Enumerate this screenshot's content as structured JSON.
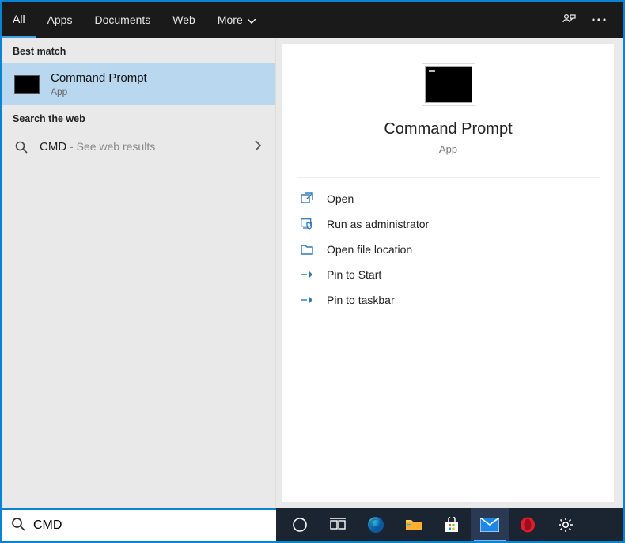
{
  "header": {
    "tabs": [
      {
        "label": "All",
        "active": true
      },
      {
        "label": "Apps",
        "active": false
      },
      {
        "label": "Documents",
        "active": false
      },
      {
        "label": "Web",
        "active": false
      },
      {
        "label": "More",
        "active": false,
        "dropdown": true
      }
    ]
  },
  "left": {
    "best_match_heading": "Best match",
    "best_item": {
      "title": "Command Prompt",
      "subtitle": "App"
    },
    "search_web_heading": "Search the web",
    "web_item": {
      "query": "CMD",
      "suffix": " - See web results"
    }
  },
  "preview": {
    "title": "Command Prompt",
    "subtitle": "App",
    "actions": [
      {
        "icon": "open-icon",
        "label": "Open"
      },
      {
        "icon": "admin-icon",
        "label": "Run as administrator"
      },
      {
        "icon": "folder-icon",
        "label": "Open file location"
      },
      {
        "icon": "pin-start-icon",
        "label": "Pin to Start"
      },
      {
        "icon": "pin-taskbar-icon",
        "label": "Pin to taskbar"
      }
    ]
  },
  "search": {
    "icon": "search-icon",
    "value": "CMD"
  },
  "taskbar": {
    "items": [
      {
        "name": "cortana-icon"
      },
      {
        "name": "task-view-icon"
      },
      {
        "name": "edge-icon"
      },
      {
        "name": "file-explorer-icon"
      },
      {
        "name": "store-icon"
      },
      {
        "name": "mail-icon",
        "active": true
      },
      {
        "name": "opera-icon"
      },
      {
        "name": "settings-gear-icon"
      }
    ]
  }
}
